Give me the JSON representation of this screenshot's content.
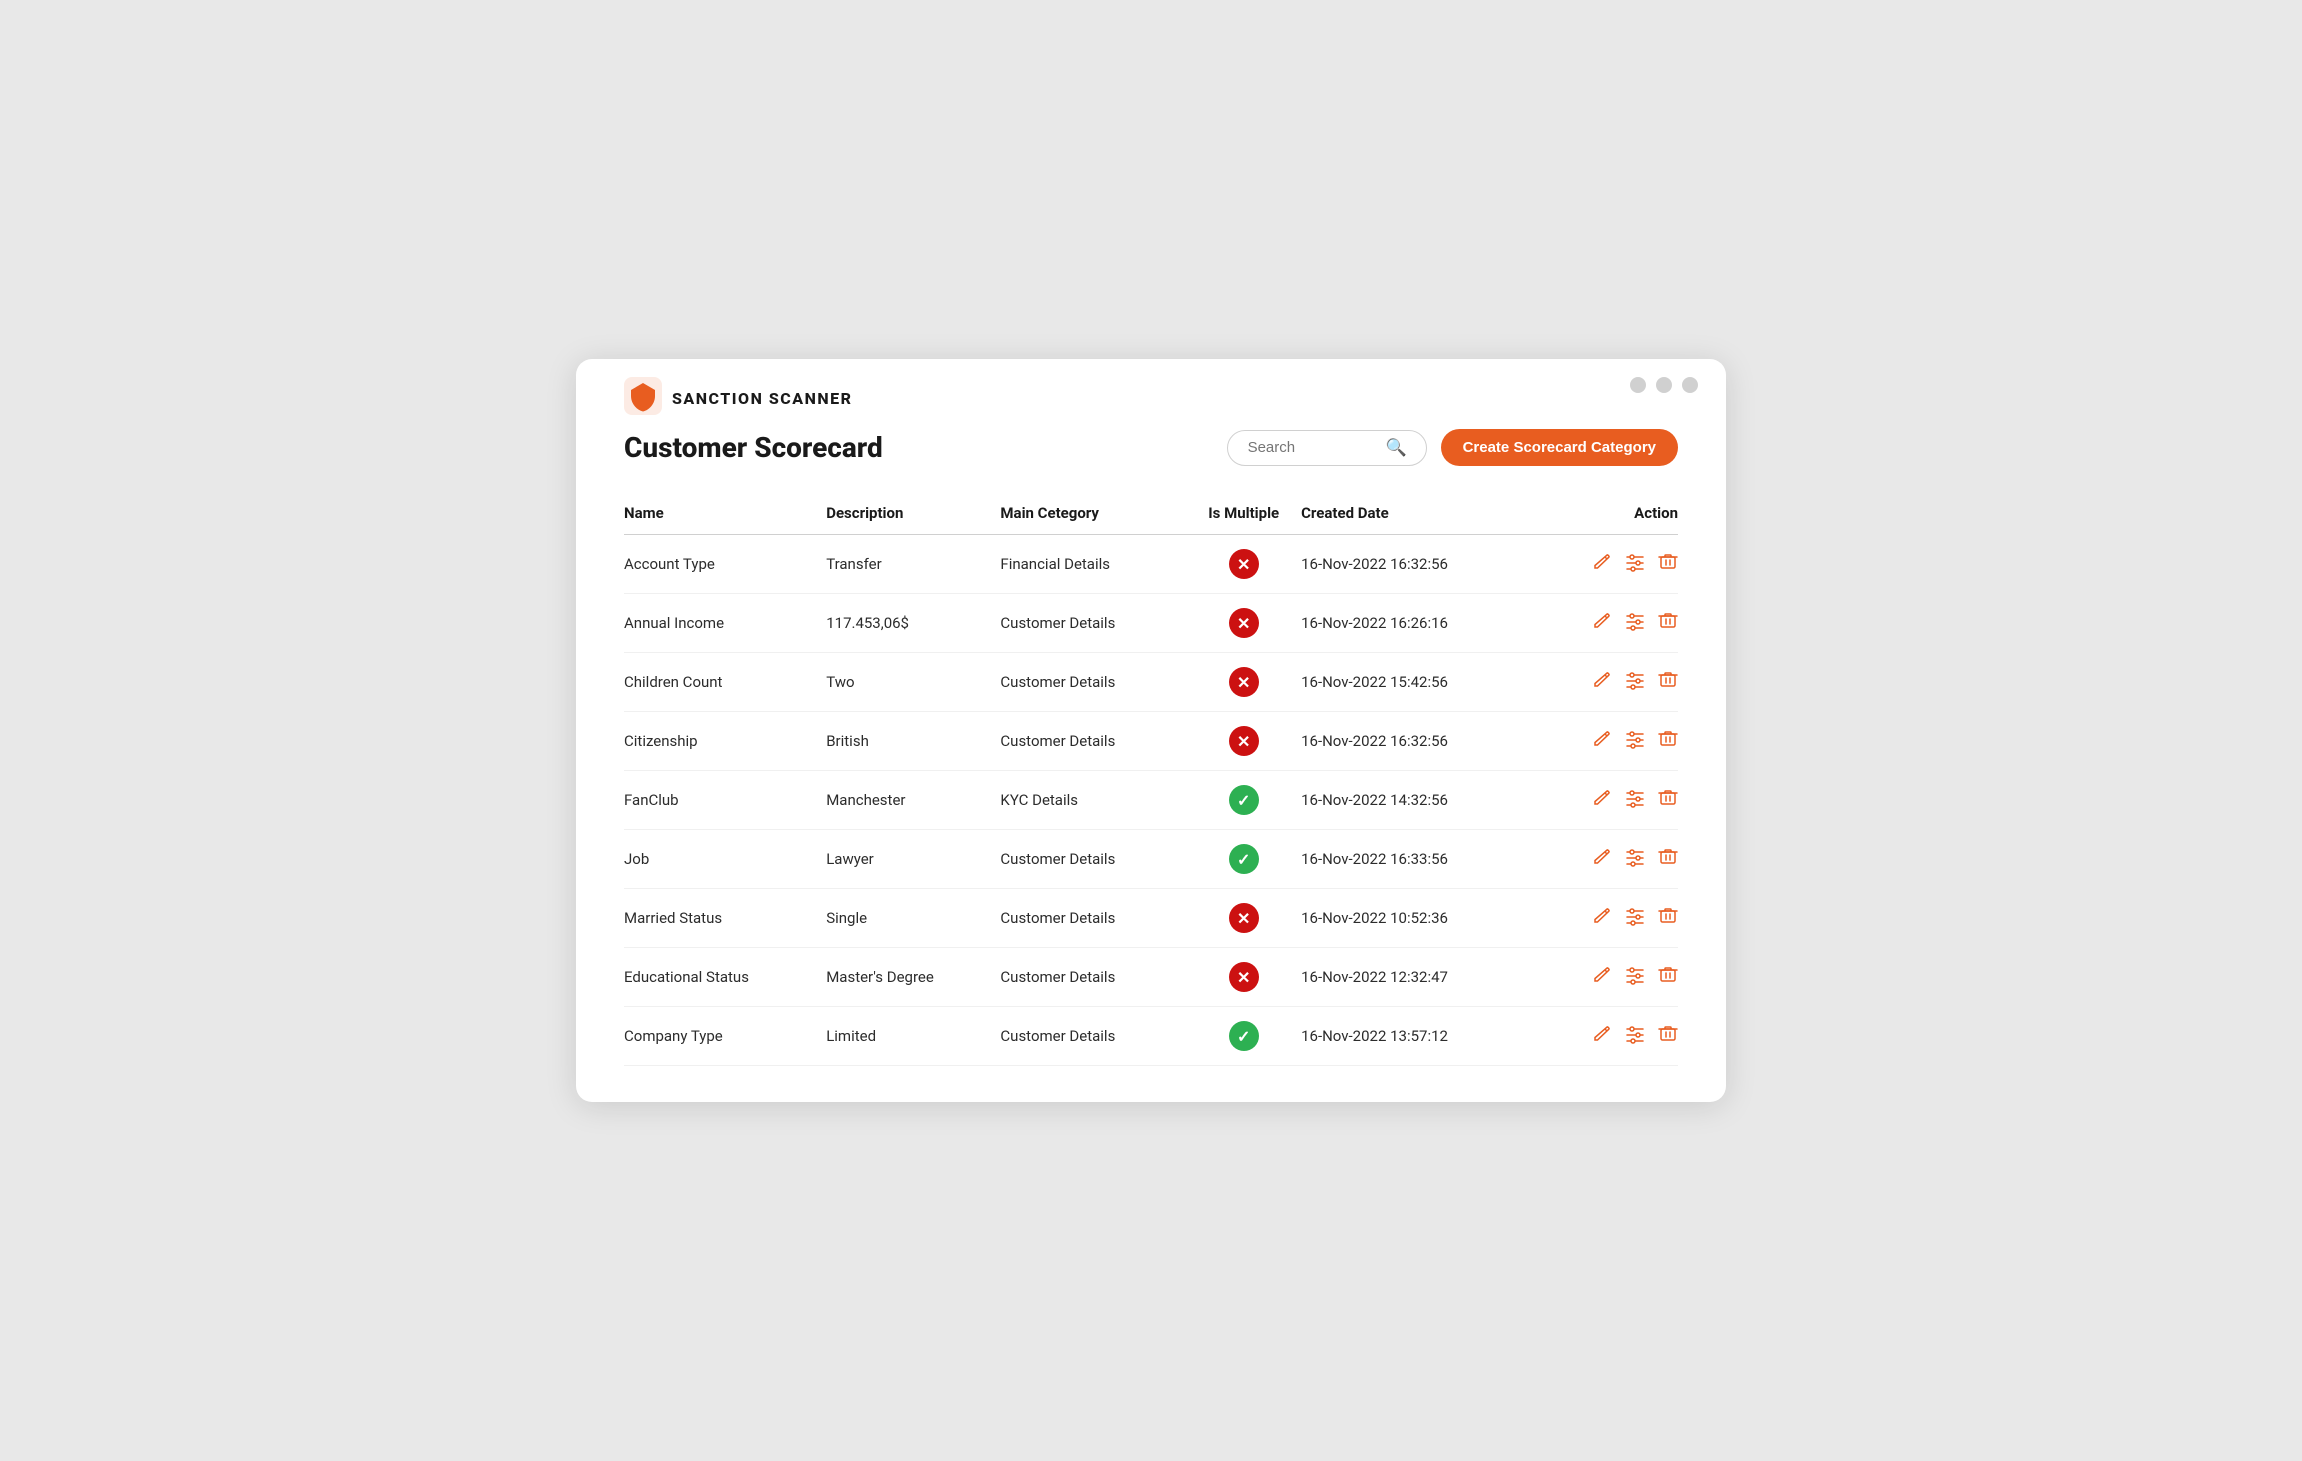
{
  "header": {
    "logo_text": "SANCTION SCANNER"
  },
  "titlebar": {
    "dots": [
      "dot1",
      "dot2",
      "dot3"
    ]
  },
  "page": {
    "title": "Customer Scorecard",
    "search_placeholder": "Search",
    "create_button_label": "Create Scorecard Category"
  },
  "table": {
    "columns": [
      {
        "key": "name",
        "label": "Name"
      },
      {
        "key": "description",
        "label": "Description"
      },
      {
        "key": "main_category",
        "label": "Main Cetegory"
      },
      {
        "key": "is_multiple",
        "label": "Is Multiple"
      },
      {
        "key": "created_date",
        "label": "Created Date"
      },
      {
        "key": "action",
        "label": "Action"
      }
    ],
    "rows": [
      {
        "name": "Account Type",
        "description": "Transfer",
        "main_category": "Financial Details",
        "is_multiple": false,
        "created_date": "16-Nov-2022 16:32:56"
      },
      {
        "name": "Annual Income",
        "description": "117.453,06$",
        "main_category": "Customer Details",
        "is_multiple": false,
        "created_date": "16-Nov-2022 16:26:16"
      },
      {
        "name": "Children Count",
        "description": "Two",
        "main_category": "Customer Details",
        "is_multiple": false,
        "created_date": "16-Nov-2022 15:42:56"
      },
      {
        "name": "Citizenship",
        "description": "British",
        "main_category": "Customer Details",
        "is_multiple": false,
        "created_date": "16-Nov-2022 16:32:56"
      },
      {
        "name": "FanClub",
        "description": "Manchester",
        "main_category": "KYC Details",
        "is_multiple": true,
        "created_date": "16-Nov-2022 14:32:56"
      },
      {
        "name": "Job",
        "description": "Lawyer",
        "main_category": "Customer Details",
        "is_multiple": true,
        "created_date": "16-Nov-2022 16:33:56"
      },
      {
        "name": "Married Status",
        "description": "Single",
        "main_category": "Customer Details",
        "is_multiple": false,
        "created_date": "16-Nov-2022 10:52:36"
      },
      {
        "name": "Educational Status",
        "description": "Master's Degree",
        "main_category": "Customer Details",
        "is_multiple": false,
        "created_date": "16-Nov-2022 12:32:47"
      },
      {
        "name": "Company Type",
        "description": "Limited",
        "main_category": "Customer Details",
        "is_multiple": true,
        "created_date": "16-Nov-2022 13:57:12"
      }
    ]
  },
  "colors": {
    "accent": "#e85d20",
    "false_color": "#cc1111",
    "true_color": "#2db052"
  }
}
